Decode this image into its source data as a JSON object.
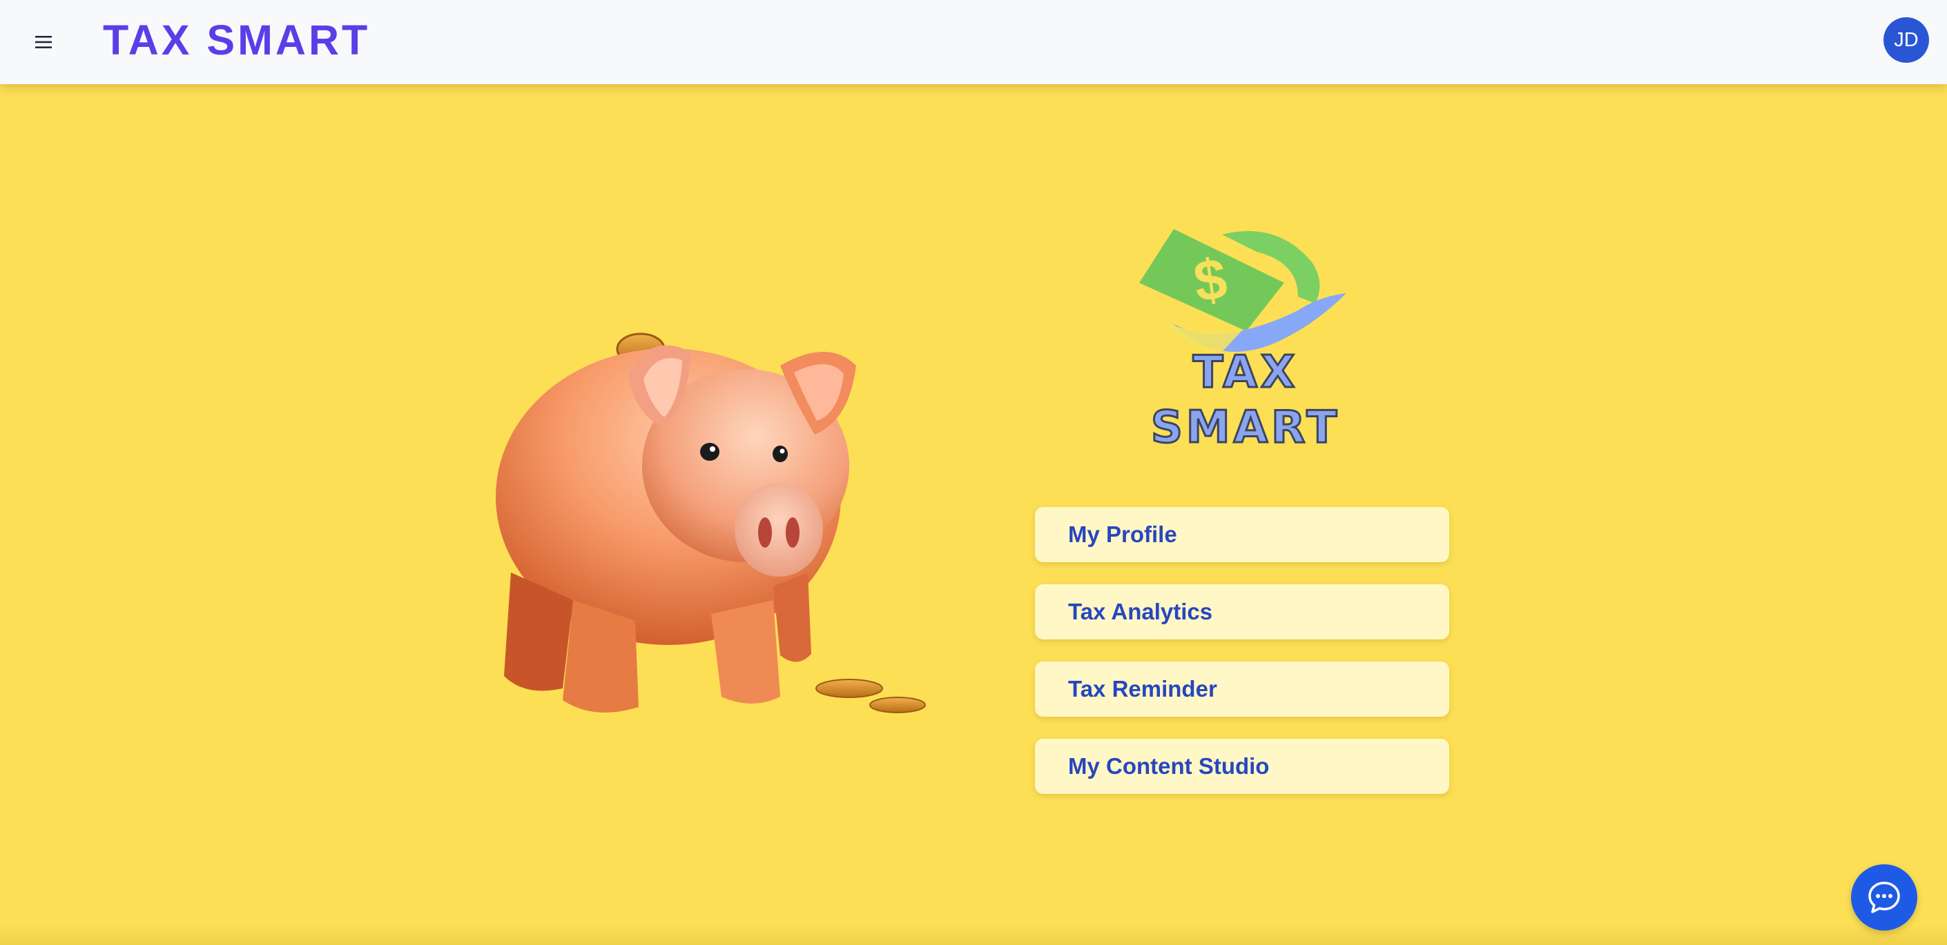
{
  "header": {
    "brand": "TAX SMART",
    "menu_icon": "hamburger-menu-icon",
    "avatar_initials": "JD"
  },
  "hero": {
    "image_icon": "piggy-bank-illustration",
    "logo_text": "TAX SMART",
    "logo_icon": "dollar-bill-hand-icon"
  },
  "nav": {
    "items": [
      {
        "label": "My Profile"
      },
      {
        "label": "Tax Analytics"
      },
      {
        "label": "Tax Reminder"
      },
      {
        "label": "My Content Studio"
      }
    ]
  },
  "chat": {
    "icon": "chat-bubble-icon"
  },
  "colors": {
    "background": "#fcdf55",
    "topbar": "#f8f9fb",
    "brand": "#5b3ee8",
    "avatar": "#2a56d6",
    "nav_item_bg": "#fff7c5",
    "nav_item_text": "#2746bf",
    "chat_button": "#1f5ae6"
  }
}
